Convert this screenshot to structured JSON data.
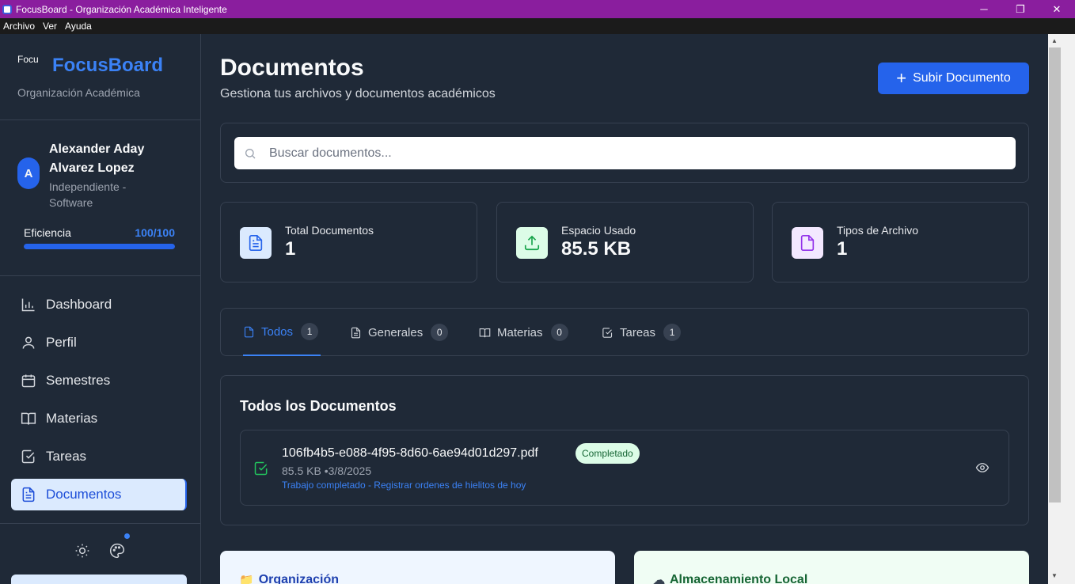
{
  "window": {
    "title": "FocusBoard - Organización Académica Inteligente",
    "controls": {
      "minimize": "─",
      "maximize": "❐",
      "close": "✕"
    }
  },
  "menu": [
    "Archivo",
    "Ver",
    "Ayuda"
  ],
  "sidebar": {
    "logo_alt": "Focu",
    "brand": "FocusBoard",
    "brand_sub": "Organización Académica",
    "user": {
      "initial": "A",
      "name": "Alexander Aday Alvarez Lopez",
      "role": "Independiente - Software"
    },
    "efficiency": {
      "label": "Eficiencia",
      "value": "100/100",
      "fraction": 1.0
    },
    "nav": [
      {
        "label": "Dashboard",
        "icon": "bar-chart-icon"
      },
      {
        "label": "Perfil",
        "icon": "user-icon"
      },
      {
        "label": "Semestres",
        "icon": "calendar-icon"
      },
      {
        "label": "Materias",
        "icon": "book-icon"
      },
      {
        "label": "Tareas",
        "icon": "check-square-icon"
      },
      {
        "label": "Documentos",
        "icon": "file-text-icon",
        "active": true
      }
    ]
  },
  "header": {
    "title": "Documentos",
    "subtitle": "Gestiona tus archivos y documentos académicos",
    "upload_label": "Subir Documento"
  },
  "search": {
    "placeholder": "Buscar documentos..."
  },
  "stats": [
    {
      "label": "Total Documentos",
      "value": "1",
      "icon": "file-text-icon",
      "color": "#2563eb"
    },
    {
      "label": "Espacio Usado",
      "value": "85.5 KB",
      "icon": "upload-icon",
      "color": "#16a34a"
    },
    {
      "label": "Tipos de Archivo",
      "value": "1",
      "icon": "file-icon",
      "color": "#9333ea"
    }
  ],
  "tabs": [
    {
      "label": "Todos",
      "count": "1",
      "active": true
    },
    {
      "label": "Generales",
      "count": "0"
    },
    {
      "label": "Materias",
      "count": "0"
    },
    {
      "label": "Tareas",
      "count": "1"
    }
  ],
  "documents": {
    "title": "Todos los Documentos",
    "items": [
      {
        "name": "106fb4b5-e088-4f95-8d60-6ae94d01d297.pdf",
        "status": "Completado",
        "meta": "85.5 KB •3/8/2025",
        "link": "Trabajo completado - Registrar ordenes de hielitos de hoy"
      }
    ]
  },
  "info_cards": [
    {
      "title": "Organización",
      "icon": "📁"
    },
    {
      "title": "Almacenamiento Local",
      "icon": "☁"
    }
  ],
  "colors": {
    "accent": "#2563eb",
    "success": "#22c55e",
    "titlebar": "#8a1e9e"
  }
}
